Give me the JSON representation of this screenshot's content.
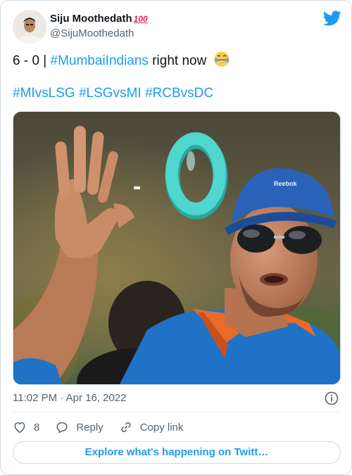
{
  "author": {
    "name": "Siju Moothedath",
    "name_emoji": "100",
    "handle": "@SijuMoothedath"
  },
  "tweet": {
    "score": "6 - 0 | ",
    "hashtag_main": "#MumbaiIndians",
    "suffix": " right now",
    "emoji": "face-with-tears-of-joy",
    "hashtags": [
      "#MIvsLSG",
      "#LSGvsMI",
      "#RCBvsDC"
    ]
  },
  "media": {
    "overlay_text": "- 0",
    "cap_logo": "Reebok"
  },
  "meta": {
    "timestamp": "11:02 PM · Apr 16, 2022"
  },
  "actions": {
    "likes": "8",
    "reply_label": "Reply",
    "copy_label": "Copy link"
  },
  "explore_label": "Explore what's happening on Twitt…",
  "colors": {
    "accent": "#1d9bf0",
    "text_secondary": "#536471",
    "border": "#cfd9de",
    "jersey": "#1f72c6",
    "collar": "#e86b2a",
    "zero": "#4fd6cf"
  }
}
